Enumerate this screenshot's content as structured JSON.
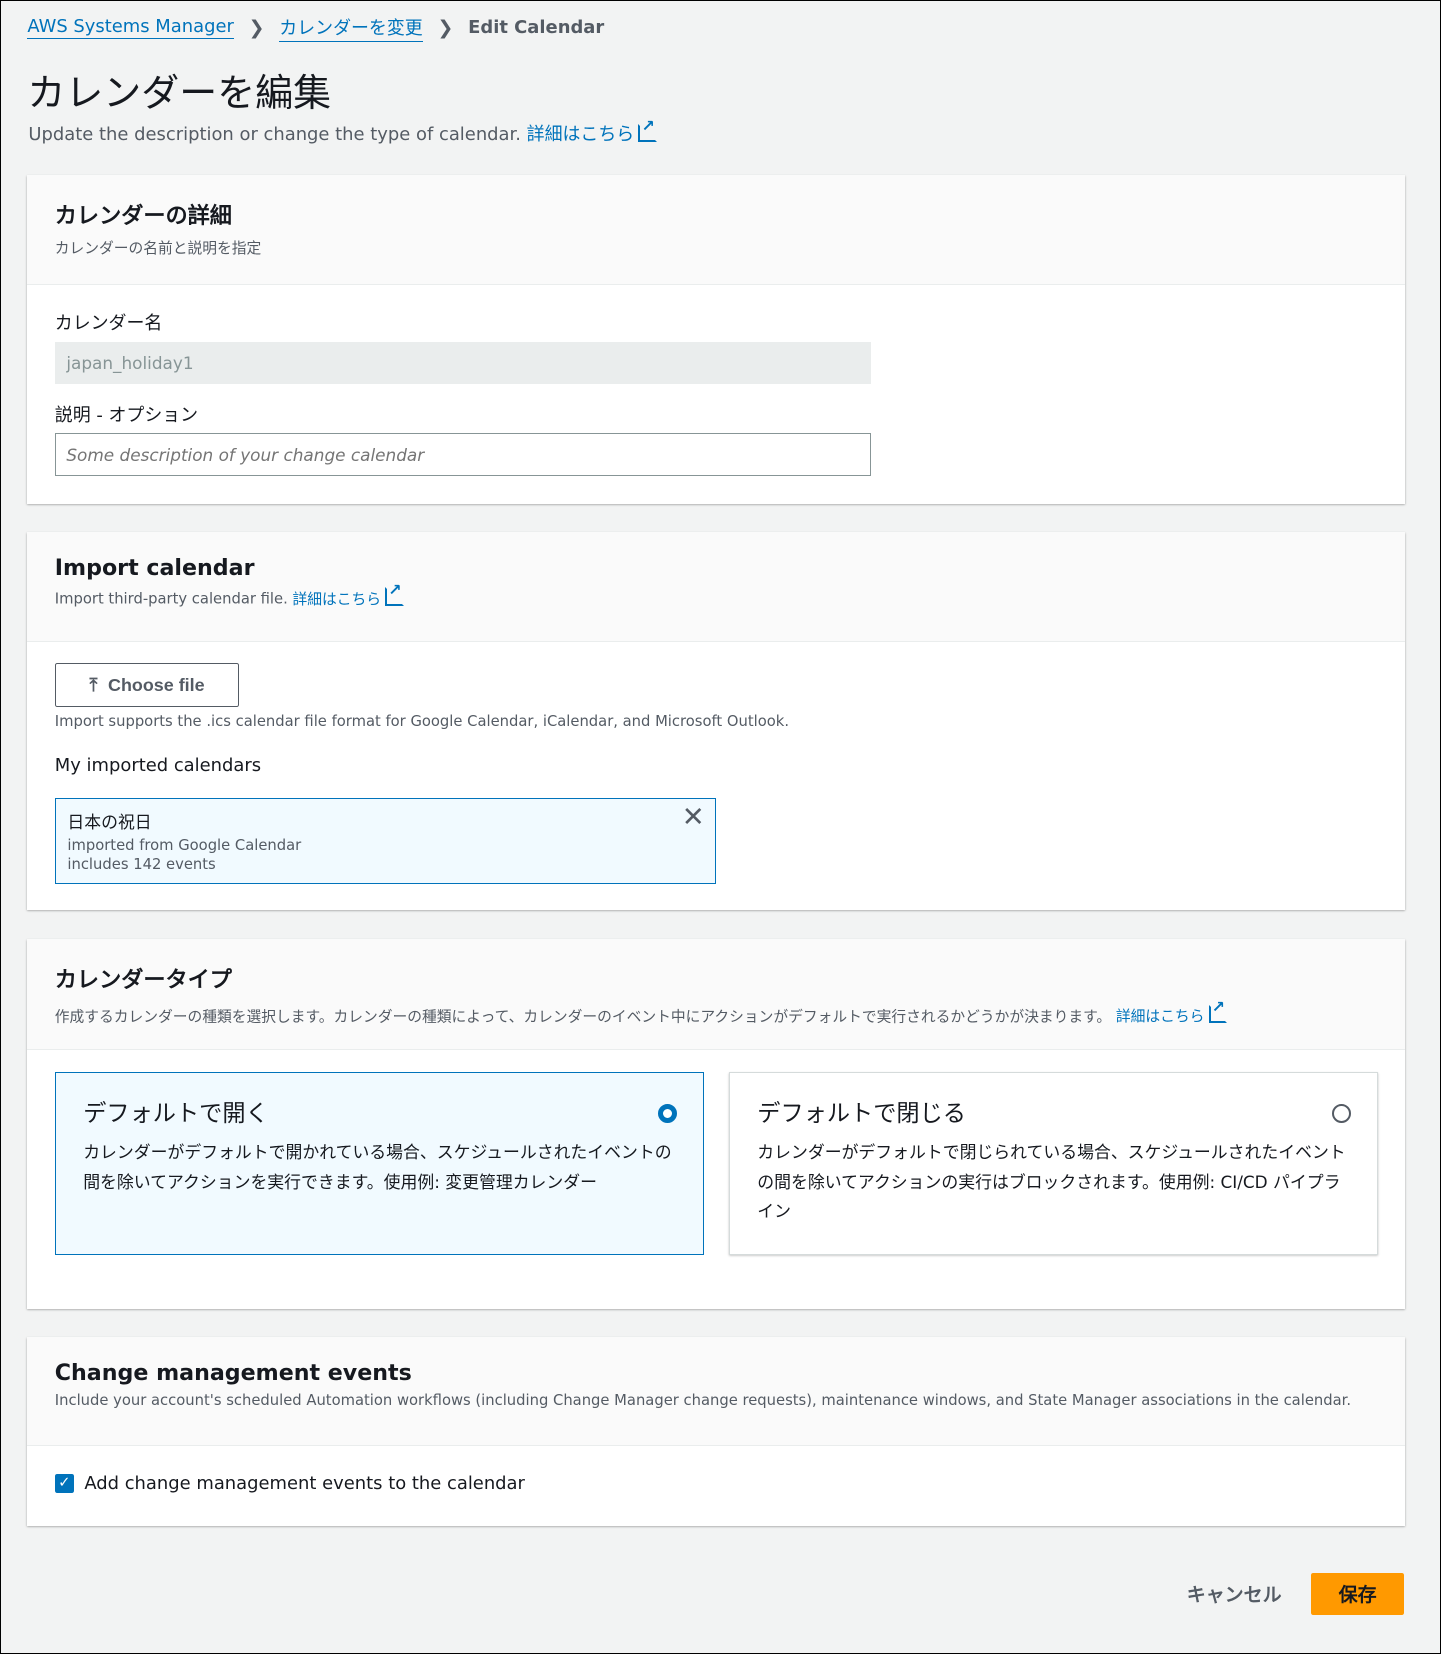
{
  "breadcrumb": [
    "AWS Systems Manager",
    "カレンダーを変更",
    "Edit Calendar"
  ],
  "title": "カレンダーを編集",
  "subtitle": "Update the description or change the type of calendar.",
  "learn_more": "詳細はこちら",
  "details": {
    "title": "カレンダーの詳細",
    "desc": "カレンダーの名前と説明を指定",
    "name_label": "カレンダー名",
    "name_value": "japan_holiday1",
    "desc_label": "説明 - オプション",
    "desc_placeholder": "Some description of your change calendar"
  },
  "import": {
    "title": "Import calendar",
    "desc": "Import third-party calendar file.",
    "choose": "Choose file",
    "hint": "Import supports the .ics calendar file format for Google Calendar, iCalendar, and Microsoft Outlook.",
    "my_label": "My imported calendars",
    "item": {
      "name": "日本の祝日",
      "source": "imported from Google Calendar",
      "count": "includes 142 events"
    }
  },
  "type": {
    "title": "カレンダータイプ",
    "desc": "作成するカレンダーの種類を選択します。カレンダーの種類によって、カレンダーのイベント中にアクションがデフォルトで実行されるかどうかが決まります。",
    "options": [
      {
        "title": "デフォルトで開く",
        "desc": "カレンダーがデフォルトで開かれている場合、スケジュールされたイベントの間を除いてアクションを実行できます。使用例: 変更管理カレンダー",
        "selected": true
      },
      {
        "title": "デフォルトで閉じる",
        "desc": "カレンダーがデフォルトで閉じられている場合、スケジュールされたイベントの間を除いてアクションの実行はブロックされます。使用例: CI/CD パイプライン",
        "selected": false
      }
    ]
  },
  "cm": {
    "title": "Change management events",
    "desc": "Include your account's scheduled Automation workflows (including Change Manager change requests), maintenance windows, and State Manager associations in the calendar.",
    "checkbox": "Add change management events to the calendar",
    "checked": true
  },
  "actions": {
    "cancel": "キャンセル",
    "save": "保存"
  },
  "colors": {
    "link": "#0073bb",
    "primary": "#ff9900"
  }
}
